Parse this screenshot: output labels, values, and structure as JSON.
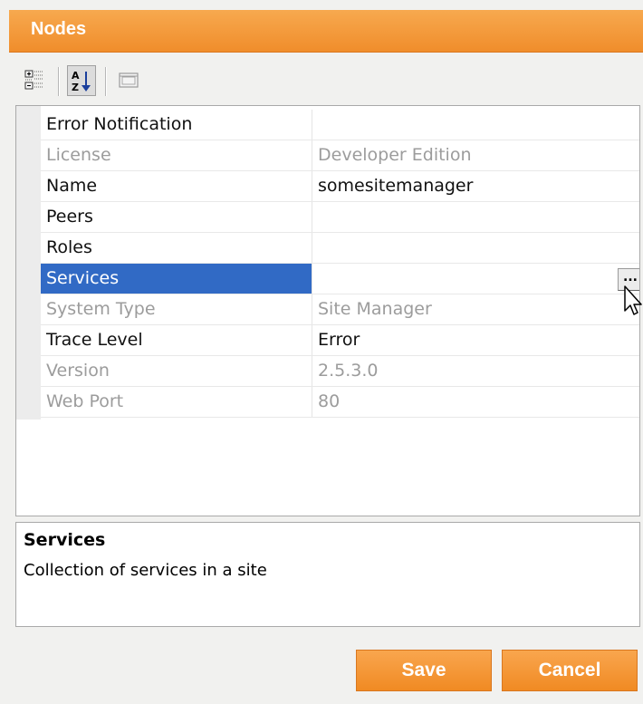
{
  "window": {
    "title": "Nodes"
  },
  "toolbar": {
    "buttons": [
      {
        "name": "categorized-view",
        "icon": "categorized-icon"
      },
      {
        "name": "alphabetical-sort",
        "icon": "sort-az-icon"
      },
      {
        "name": "property-pages",
        "icon": "property-pages-icon"
      }
    ]
  },
  "properties": {
    "rows": [
      {
        "name": "Error Notification",
        "value": "",
        "readonly": false
      },
      {
        "name": "License",
        "value": "Developer Edition",
        "readonly": true
      },
      {
        "name": "Name",
        "value": "somesitemanager",
        "readonly": false
      },
      {
        "name": "Peers",
        "value": "",
        "readonly": false
      },
      {
        "name": "Roles",
        "value": "",
        "readonly": false
      },
      {
        "name": "Services",
        "value": "",
        "readonly": false,
        "selected": true,
        "button_label": "..."
      },
      {
        "name": "System Type",
        "value": "Site Manager",
        "readonly": true
      },
      {
        "name": "Trace Level",
        "value": "Error",
        "readonly": false
      },
      {
        "name": "Version",
        "value": "2.5.3.0",
        "readonly": true
      },
      {
        "name": "Web Port",
        "value": "80",
        "readonly": true
      }
    ]
  },
  "description": {
    "title": "Services",
    "text": "Collection of services in a site"
  },
  "actions": {
    "save_label": "Save",
    "cancel_label": "Cancel"
  },
  "colors": {
    "accent_orange": "#f08d2b",
    "selection_blue": "#316ac5"
  }
}
